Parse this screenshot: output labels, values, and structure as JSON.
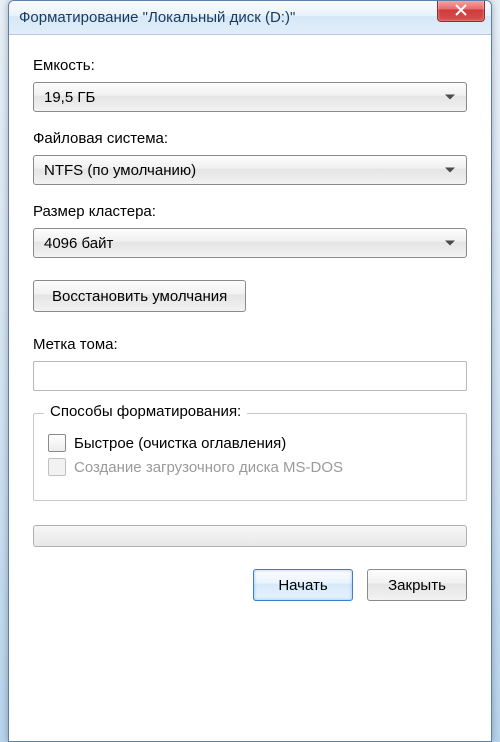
{
  "window": {
    "title": "Форматирование \"Локальный диск (D:)\""
  },
  "capacity": {
    "label": "Емкость:",
    "value": "19,5 ГБ"
  },
  "filesystem": {
    "label": "Файловая система:",
    "value": "NTFS (по умолчанию)"
  },
  "cluster": {
    "label": "Размер кластера:",
    "value": "4096 байт"
  },
  "restore_defaults": {
    "label": "Восстановить умолчания"
  },
  "volume_label": {
    "label": "Метка тома:",
    "value": ""
  },
  "format_options": {
    "legend": "Способы форматирования:",
    "quick": {
      "label": "Быстрое (очистка оглавления)",
      "checked": false
    },
    "msdos": {
      "label": "Создание загрузочного диска MS-DOS",
      "checked": false,
      "enabled": false
    }
  },
  "footer": {
    "start": "Начать",
    "close": "Закрыть"
  }
}
